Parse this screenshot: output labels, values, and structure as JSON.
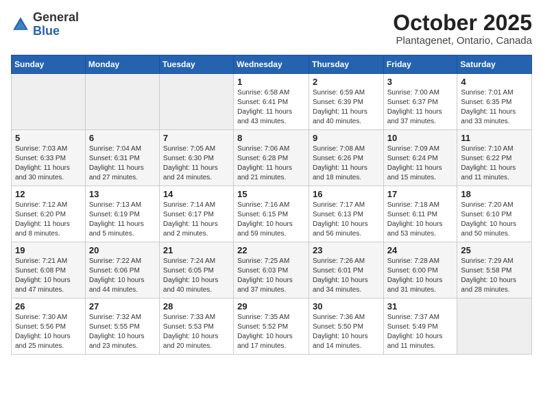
{
  "header": {
    "logo_line1": "General",
    "logo_line2": "Blue",
    "title": "October 2025",
    "subtitle": "Plantagenet, Ontario, Canada"
  },
  "days_of_week": [
    "Sunday",
    "Monday",
    "Tuesday",
    "Wednesday",
    "Thursday",
    "Friday",
    "Saturday"
  ],
  "weeks": [
    [
      {
        "num": "",
        "sunrise": "",
        "sunset": "",
        "daylight": ""
      },
      {
        "num": "",
        "sunrise": "",
        "sunset": "",
        "daylight": ""
      },
      {
        "num": "",
        "sunrise": "",
        "sunset": "",
        "daylight": ""
      },
      {
        "num": "1",
        "sunrise": "Sunrise: 6:58 AM",
        "sunset": "Sunset: 6:41 PM",
        "daylight": "Daylight: 11 hours and 43 minutes."
      },
      {
        "num": "2",
        "sunrise": "Sunrise: 6:59 AM",
        "sunset": "Sunset: 6:39 PM",
        "daylight": "Daylight: 11 hours and 40 minutes."
      },
      {
        "num": "3",
        "sunrise": "Sunrise: 7:00 AM",
        "sunset": "Sunset: 6:37 PM",
        "daylight": "Daylight: 11 hours and 37 minutes."
      },
      {
        "num": "4",
        "sunrise": "Sunrise: 7:01 AM",
        "sunset": "Sunset: 6:35 PM",
        "daylight": "Daylight: 11 hours and 33 minutes."
      }
    ],
    [
      {
        "num": "5",
        "sunrise": "Sunrise: 7:03 AM",
        "sunset": "Sunset: 6:33 PM",
        "daylight": "Daylight: 11 hours and 30 minutes."
      },
      {
        "num": "6",
        "sunrise": "Sunrise: 7:04 AM",
        "sunset": "Sunset: 6:31 PM",
        "daylight": "Daylight: 11 hours and 27 minutes."
      },
      {
        "num": "7",
        "sunrise": "Sunrise: 7:05 AM",
        "sunset": "Sunset: 6:30 PM",
        "daylight": "Daylight: 11 hours and 24 minutes."
      },
      {
        "num": "8",
        "sunrise": "Sunrise: 7:06 AM",
        "sunset": "Sunset: 6:28 PM",
        "daylight": "Daylight: 11 hours and 21 minutes."
      },
      {
        "num": "9",
        "sunrise": "Sunrise: 7:08 AM",
        "sunset": "Sunset: 6:26 PM",
        "daylight": "Daylight: 11 hours and 18 minutes."
      },
      {
        "num": "10",
        "sunrise": "Sunrise: 7:09 AM",
        "sunset": "Sunset: 6:24 PM",
        "daylight": "Daylight: 11 hours and 15 minutes."
      },
      {
        "num": "11",
        "sunrise": "Sunrise: 7:10 AM",
        "sunset": "Sunset: 6:22 PM",
        "daylight": "Daylight: 11 hours and 11 minutes."
      }
    ],
    [
      {
        "num": "12",
        "sunrise": "Sunrise: 7:12 AM",
        "sunset": "Sunset: 6:20 PM",
        "daylight": "Daylight: 11 hours and 8 minutes."
      },
      {
        "num": "13",
        "sunrise": "Sunrise: 7:13 AM",
        "sunset": "Sunset: 6:19 PM",
        "daylight": "Daylight: 11 hours and 5 minutes."
      },
      {
        "num": "14",
        "sunrise": "Sunrise: 7:14 AM",
        "sunset": "Sunset: 6:17 PM",
        "daylight": "Daylight: 11 hours and 2 minutes."
      },
      {
        "num": "15",
        "sunrise": "Sunrise: 7:16 AM",
        "sunset": "Sunset: 6:15 PM",
        "daylight": "Daylight: 10 hours and 59 minutes."
      },
      {
        "num": "16",
        "sunrise": "Sunrise: 7:17 AM",
        "sunset": "Sunset: 6:13 PM",
        "daylight": "Daylight: 10 hours and 56 minutes."
      },
      {
        "num": "17",
        "sunrise": "Sunrise: 7:18 AM",
        "sunset": "Sunset: 6:11 PM",
        "daylight": "Daylight: 10 hours and 53 minutes."
      },
      {
        "num": "18",
        "sunrise": "Sunrise: 7:20 AM",
        "sunset": "Sunset: 6:10 PM",
        "daylight": "Daylight: 10 hours and 50 minutes."
      }
    ],
    [
      {
        "num": "19",
        "sunrise": "Sunrise: 7:21 AM",
        "sunset": "Sunset: 6:08 PM",
        "daylight": "Daylight: 10 hours and 47 minutes."
      },
      {
        "num": "20",
        "sunrise": "Sunrise: 7:22 AM",
        "sunset": "Sunset: 6:06 PM",
        "daylight": "Daylight: 10 hours and 44 minutes."
      },
      {
        "num": "21",
        "sunrise": "Sunrise: 7:24 AM",
        "sunset": "Sunset: 6:05 PM",
        "daylight": "Daylight: 10 hours and 40 minutes."
      },
      {
        "num": "22",
        "sunrise": "Sunrise: 7:25 AM",
        "sunset": "Sunset: 6:03 PM",
        "daylight": "Daylight: 10 hours and 37 minutes."
      },
      {
        "num": "23",
        "sunrise": "Sunrise: 7:26 AM",
        "sunset": "Sunset: 6:01 PM",
        "daylight": "Daylight: 10 hours and 34 minutes."
      },
      {
        "num": "24",
        "sunrise": "Sunrise: 7:28 AM",
        "sunset": "Sunset: 6:00 PM",
        "daylight": "Daylight: 10 hours and 31 minutes."
      },
      {
        "num": "25",
        "sunrise": "Sunrise: 7:29 AM",
        "sunset": "Sunset: 5:58 PM",
        "daylight": "Daylight: 10 hours and 28 minutes."
      }
    ],
    [
      {
        "num": "26",
        "sunrise": "Sunrise: 7:30 AM",
        "sunset": "Sunset: 5:56 PM",
        "daylight": "Daylight: 10 hours and 25 minutes."
      },
      {
        "num": "27",
        "sunrise": "Sunrise: 7:32 AM",
        "sunset": "Sunset: 5:55 PM",
        "daylight": "Daylight: 10 hours and 23 minutes."
      },
      {
        "num": "28",
        "sunrise": "Sunrise: 7:33 AM",
        "sunset": "Sunset: 5:53 PM",
        "daylight": "Daylight: 10 hours and 20 minutes."
      },
      {
        "num": "29",
        "sunrise": "Sunrise: 7:35 AM",
        "sunset": "Sunset: 5:52 PM",
        "daylight": "Daylight: 10 hours and 17 minutes."
      },
      {
        "num": "30",
        "sunrise": "Sunrise: 7:36 AM",
        "sunset": "Sunset: 5:50 PM",
        "daylight": "Daylight: 10 hours and 14 minutes."
      },
      {
        "num": "31",
        "sunrise": "Sunrise: 7:37 AM",
        "sunset": "Sunset: 5:49 PM",
        "daylight": "Daylight: 10 hours and 11 minutes."
      },
      {
        "num": "",
        "sunrise": "",
        "sunset": "",
        "daylight": ""
      }
    ]
  ]
}
